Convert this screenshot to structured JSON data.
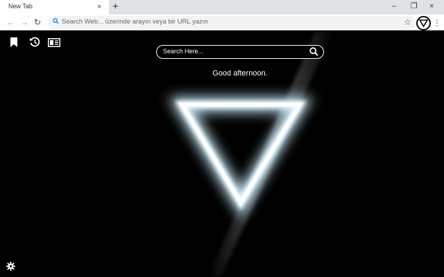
{
  "browser": {
    "tab_title": "New Tab",
    "tab_close": "×",
    "new_tab": "+",
    "window_controls": {
      "minimize": "–",
      "restore": "❐",
      "close": "×"
    },
    "nav": {
      "back": "←",
      "forward": "→",
      "reload": "↻"
    },
    "omnibox_placeholder": "Search Web... üzerinde arayın veya bir URL yazın",
    "star": "☆",
    "menu": "⋮",
    "extension_icon": "triangle-icon"
  },
  "page": {
    "search_placeholder": "Search Here...",
    "greeting": "Good afternoon.",
    "left_icons": [
      "bookmark-icon",
      "history-icon",
      "news-icon"
    ],
    "settings_icon": "gear-icon",
    "colors": {
      "background": "#000000",
      "glow": "#ffffff",
      "accent": "#dff6ff"
    }
  }
}
